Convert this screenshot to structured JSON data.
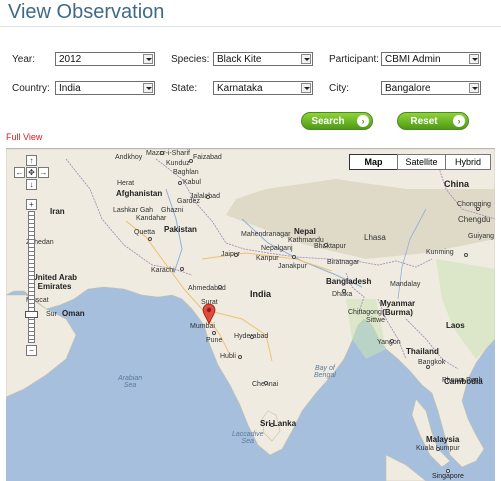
{
  "page": {
    "title": "View Observation"
  },
  "filters": {
    "year": {
      "label": "Year:",
      "value": "2012"
    },
    "species": {
      "label": "Species:",
      "value": "Black Kite"
    },
    "participant": {
      "label": "Participant:",
      "value": "CBMI Admin"
    },
    "country": {
      "label": "Country:",
      "value": "India"
    },
    "state": {
      "label": "State:",
      "value": "Karnataka"
    },
    "city": {
      "label": "City:",
      "value": "Bangalore"
    }
  },
  "actions": {
    "search_label": "Search",
    "reset_label": "Reset"
  },
  "full_view_label": "Full View",
  "map": {
    "type_buttons": [
      "Map",
      "Satellite",
      "Hybrid"
    ],
    "active_type": "Map",
    "countries": [
      "Afghanistan",
      "Pakistan",
      "India",
      "China",
      "Nepal",
      "Bangladesh",
      "Myanmar\n(Burma)",
      "Thailand",
      "Laos",
      "Cambodia",
      "Sri Lanka",
      "Malaysia",
      "Iran",
      "Oman",
      "United Arab\nEmirates",
      "Singapore",
      "Chengdu",
      "Lhasa"
    ],
    "seas": [
      "Arabian\nSea",
      "Bay of\nBengal",
      "Laccadive\nSea"
    ],
    "cities": [
      "Andkhoy",
      "Mazar-i-Sharif",
      "Faizabad",
      "Kunduz",
      "Baghlan",
      "Herat",
      "Kabul",
      "Jalalabad",
      "Lashkar Gah",
      "Gardez",
      "Kandahar",
      "Ghazni",
      "Zahedan",
      "Quetta",
      "Mahendranagar",
      "Nepalganj",
      "Kathmandu",
      "Bhaktapur",
      "Kanpur",
      "Biratnagar",
      "Janakpur",
      "Karachi",
      "Jaipur",
      "Ahmedabad",
      "Surat",
      "Mumbai",
      "Pune",
      "Hubli",
      "Hyderabad",
      "Chennai",
      "Muscat",
      "Sur",
      "Yangon",
      "Bangkok",
      "Kuala Lumpur",
      "Phnom Penh",
      "Chongqing",
      "Guiyang",
      "Kunming",
      "Dhaka",
      "Chittagong",
      "Mandalay",
      "Sittwe"
    ],
    "marker_city": "Mumbai"
  }
}
